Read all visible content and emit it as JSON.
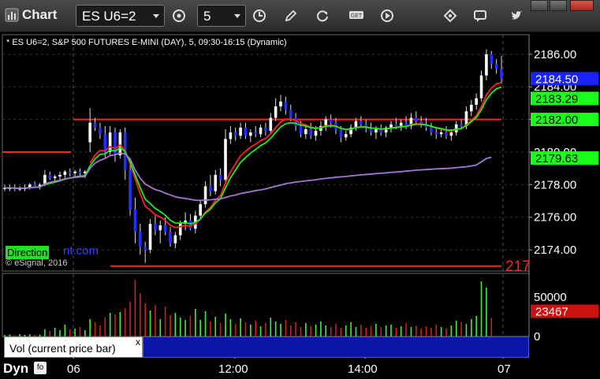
{
  "titlebar": {
    "app_title": "Chart",
    "symbol": "ES U6=2",
    "interval": "5",
    "icons": [
      "clock-settings-icon",
      "time-icon",
      "pencil-icon",
      "refresh-icon",
      "get-icon",
      "play-icon",
      "diamond-tool-icon",
      "chat-icon",
      "twitter-icon"
    ]
  },
  "chart_header": "* ES U6=2, S&P 500 FUTURES E-MINI (DAY), 5, 09:30-16:15 (Dynamic)",
  "copyright": "© eSignal, 2016",
  "watermark": {
    "highlight": "Direction",
    "rest": "nt.com"
  },
  "volume_pane": {
    "label": "Vol (current price bar)",
    "close": "x",
    "last_value": "23467",
    "axis_ticks": [
      "50000",
      "0"
    ]
  },
  "status": {
    "dyn": "Dyn",
    "dyn_icon": "fo"
  },
  "x_ticks": [
    "06",
    "12:00",
    "14:00",
    "07"
  ],
  "price_axis": {
    "ticks": [
      "2186.00",
      "2184.00",
      "2182.00",
      "2180.00",
      "2178.00",
      "2176.00",
      "2174.00"
    ],
    "tags": [
      {
        "label": "2184.50",
        "price": 2184.5,
        "bg": "#1a22ff",
        "fg": "#ffffff"
      },
      {
        "label": "2183.29",
        "price": 2183.29,
        "bg": "#1aff1a",
        "fg": "#000000"
      },
      {
        "label": "2182.00",
        "price": 2182.0,
        "bg": "#1aff1a",
        "fg": "#000000"
      },
      {
        "label": "2179.63",
        "price": 2179.63,
        "bg": "#1aff1a",
        "fg": "#000000"
      }
    ],
    "cut_label": "217"
  },
  "colors": {
    "up": "#ffffff",
    "down": "#2030ff",
    "ema": "#18f018",
    "vwap": "#a676d6",
    "red_line": "#ff2222",
    "vol_up": "#40ee40",
    "vol_down": "#cc2020"
  },
  "chart_data": {
    "type": "candlestick",
    "ylim": [
      2172.7,
      2187.2
    ],
    "levels": [
      {
        "price": 2182.0,
        "color": "red",
        "label": ""
      },
      {
        "price": 2180.0,
        "color": "red",
        "label": ""
      },
      {
        "price": 2173.0,
        "color": "red",
        "label": "217"
      }
    ],
    "candles": [
      [
        2177.8,
        2178.0,
        2177.6,
        2177.8
      ],
      [
        2177.8,
        2178.0,
        2177.6,
        2177.8
      ],
      [
        2177.8,
        2178.0,
        2177.6,
        2177.7
      ],
      [
        2177.7,
        2177.9,
        2177.6,
        2177.8
      ],
      [
        2177.8,
        2178.0,
        2177.6,
        2177.8
      ],
      [
        2177.8,
        2178.1,
        2177.7,
        2178.0
      ],
      [
        2178.0,
        2178.2,
        2177.8,
        2177.9
      ],
      [
        2177.9,
        2178.1,
        2177.7,
        2178.0
      ],
      [
        2178.0,
        2178.9,
        2177.9,
        2178.6
      ],
      [
        2178.6,
        2178.8,
        2178.3,
        2178.4
      ],
      [
        2178.4,
        2178.6,
        2178.2,
        2178.5
      ],
      [
        2178.5,
        2178.8,
        2178.3,
        2178.6
      ],
      [
        2178.6,
        2178.9,
        2178.4,
        2178.8
      ],
      [
        2178.8,
        2179.0,
        2178.5,
        2178.7
      ],
      [
        2178.7,
        2178.9,
        2178.5,
        2178.8
      ],
      [
        2178.8,
        2179.0,
        2178.5,
        2178.7
      ],
      [
        2178.7,
        2178.9,
        2178.4,
        2178.8
      ],
      [
        2180.6,
        2182.7,
        2180.0,
        2181.8
      ],
      [
        2181.8,
        2182.1,
        2181.3,
        2181.5
      ],
      [
        2181.5,
        2181.8,
        2180.8,
        2181.1
      ],
      [
        2181.1,
        2181.6,
        2179.6,
        2180.0
      ],
      [
        2180.0,
        2181.6,
        2179.8,
        2181.2
      ],
      [
        2181.2,
        2181.5,
        2179.4,
        2179.8
      ],
      [
        2179.8,
        2181.4,
        2179.6,
        2181.2
      ],
      [
        2181.2,
        2181.5,
        2178.3,
        2178.9
      ],
      [
        2178.9,
        2179.4,
        2176.1,
        2176.5
      ],
      [
        2176.5,
        2177.2,
        2174.4,
        2175.1
      ],
      [
        2175.1,
        2175.6,
        2173.7,
        2174.2
      ],
      [
        2174.2,
        2174.5,
        2173.2,
        2174.0
      ],
      [
        2174.0,
        2175.9,
        2173.8,
        2175.6
      ],
      [
        2175.6,
        2176.1,
        2174.9,
        2175.2
      ],
      [
        2175.2,
        2175.8,
        2174.4,
        2175.5
      ],
      [
        2175.5,
        2176.0,
        2174.9,
        2175.1
      ],
      [
        2175.1,
        2175.4,
        2174.2,
        2174.4
      ],
      [
        2174.4,
        2175.1,
        2174.1,
        2174.9
      ],
      [
        2174.9,
        2175.8,
        2174.6,
        2175.6
      ],
      [
        2175.6,
        2176.3,
        2175.2,
        2175.8
      ],
      [
        2175.8,
        2176.2,
        2175.2,
        2175.3
      ],
      [
        2175.3,
        2176.4,
        2175.0,
        2176.1
      ],
      [
        2176.1,
        2177.0,
        2175.9,
        2176.8
      ],
      [
        2176.8,
        2178.2,
        2176.6,
        2177.9
      ],
      [
        2177.9,
        2178.6,
        2177.3,
        2177.6
      ],
      [
        2177.6,
        2178.9,
        2177.4,
        2178.6
      ],
      [
        2178.6,
        2179.0,
        2177.9,
        2178.3
      ],
      [
        2178.3,
        2181.4,
        2178.0,
        2180.8
      ],
      [
        2180.8,
        2181.6,
        2180.5,
        2181.2
      ],
      [
        2181.2,
        2181.5,
        2180.7,
        2181.0
      ],
      [
        2181.0,
        2181.8,
        2180.8,
        2181.5
      ],
      [
        2181.5,
        2181.8,
        2180.8,
        2181.0
      ],
      [
        2181.0,
        2181.4,
        2180.6,
        2181.2
      ],
      [
        2181.2,
        2181.6,
        2180.9,
        2181.1
      ],
      [
        2181.1,
        2181.7,
        2180.9,
        2181.5
      ],
      [
        2181.5,
        2181.8,
        2181.0,
        2181.3
      ],
      [
        2181.3,
        2182.4,
        2181.1,
        2182.1
      ],
      [
        2182.1,
        2183.3,
        2181.9,
        2182.8
      ],
      [
        2182.8,
        2183.5,
        2182.5,
        2183.1
      ],
      [
        2183.1,
        2183.4,
        2182.3,
        2182.6
      ],
      [
        2182.6,
        2182.9,
        2181.9,
        2182.1
      ],
      [
        2182.1,
        2182.4,
        2181.3,
        2181.6
      ],
      [
        2181.6,
        2181.9,
        2180.9,
        2181.1
      ],
      [
        2181.1,
        2181.7,
        2180.8,
        2181.4
      ],
      [
        2181.4,
        2181.8,
        2180.8,
        2181.0
      ],
      [
        2181.0,
        2181.6,
        2180.7,
        2181.3
      ],
      [
        2181.3,
        2181.9,
        2181.0,
        2181.6
      ],
      [
        2181.6,
        2182.2,
        2181.3,
        2182.0
      ],
      [
        2182.0,
        2182.3,
        2181.5,
        2181.8
      ],
      [
        2181.8,
        2182.1,
        2181.1,
        2181.4
      ],
      [
        2181.4,
        2181.6,
        2180.6,
        2180.9
      ],
      [
        2180.9,
        2181.3,
        2180.7,
        2181.1
      ],
      [
        2181.1,
        2181.7,
        2180.9,
        2181.5
      ],
      [
        2181.5,
        2182.1,
        2181.3,
        2181.9
      ],
      [
        2181.9,
        2182.2,
        2181.5,
        2181.7
      ],
      [
        2181.7,
        2182.0,
        2181.2,
        2181.5
      ],
      [
        2181.5,
        2181.8,
        2181.0,
        2181.2
      ],
      [
        2181.2,
        2181.6,
        2180.8,
        2181.4
      ],
      [
        2181.4,
        2181.7,
        2181.0,
        2181.2
      ],
      [
        2181.2,
        2181.6,
        2180.9,
        2181.5
      ],
      [
        2181.5,
        2181.9,
        2181.2,
        2181.7
      ],
      [
        2181.7,
        2182.1,
        2181.4,
        2181.6
      ],
      [
        2181.6,
        2182.0,
        2181.3,
        2181.8
      ],
      [
        2181.8,
        2182.2,
        2181.4,
        2181.6
      ],
      [
        2181.6,
        2182.4,
        2181.4,
        2182.1
      ],
      [
        2182.1,
        2182.5,
        2181.7,
        2181.9
      ],
      [
        2181.9,
        2182.2,
        2181.5,
        2181.7
      ],
      [
        2181.7,
        2182.1,
        2181.3,
        2181.5
      ],
      [
        2181.5,
        2181.8,
        2181.0,
        2181.2
      ],
      [
        2181.2,
        2181.5,
        2180.8,
        2181.1
      ],
      [
        2181.1,
        2181.4,
        2180.9,
        2181.2
      ],
      [
        2181.2,
        2181.6,
        2180.8,
        2181.0
      ],
      [
        2181.0,
        2181.4,
        2180.7,
        2181.2
      ],
      [
        2181.2,
        2181.9,
        2181.0,
        2181.7
      ],
      [
        2181.7,
        2182.0,
        2181.4,
        2181.6
      ],
      [
        2181.6,
        2182.8,
        2181.4,
        2182.5
      ],
      [
        2182.5,
        2183.2,
        2182.2,
        2182.9
      ],
      [
        2182.9,
        2183.6,
        2182.6,
        2183.3
      ],
      [
        2183.3,
        2185.0,
        2183.1,
        2184.7
      ],
      [
        2184.7,
        2186.3,
        2184.4,
        2186.0
      ],
      [
        2186.0,
        2186.2,
        2185.1,
        2185.4
      ],
      [
        2185.4,
        2185.7,
        2184.8,
        2185.1
      ],
      [
        2185.1,
        2185.9,
        2184.2,
        2184.5
      ]
    ],
    "volume": [
      2000,
      2500,
      1800,
      3000,
      2200,
      2700,
      2100,
      2400,
      9000,
      7000,
      11000,
      8000,
      15000,
      9000,
      10000,
      12000,
      8000,
      22000,
      18000,
      14000,
      24000,
      30000,
      28000,
      31000,
      36000,
      44000,
      72000,
      55000,
      42000,
      33000,
      40000,
      22000,
      38000,
      27000,
      30000,
      24000,
      21000,
      26000,
      35000,
      21000,
      32000,
      19000,
      25000,
      17000,
      29000,
      22000,
      16000,
      23000,
      18000,
      15000,
      20000,
      13000,
      17000,
      24000,
      19000,
      16000,
      21000,
      14000,
      18000,
      12000,
      17000,
      13000,
      15000,
      19000,
      14000,
      12000,
      16000,
      11000,
      14000,
      18000,
      12000,
      15000,
      11000,
      13000,
      16000,
      12000,
      14000,
      15000,
      11000,
      13000,
      17000,
      12000,
      14000,
      10000,
      13000,
      11000,
      15000,
      12000,
      10000,
      14000,
      20000,
      18000,
      16000,
      22000,
      26000,
      70000,
      62000,
      23467
    ]
  }
}
